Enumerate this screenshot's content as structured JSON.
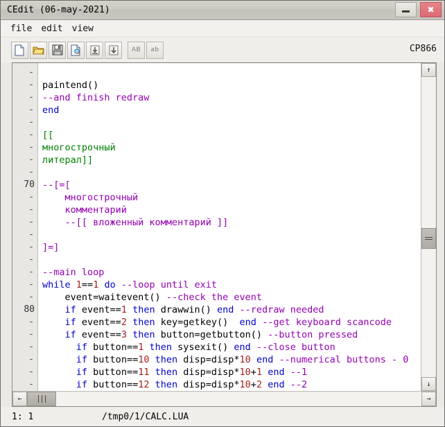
{
  "window": {
    "title": "CEdit (06-may-2021)",
    "minimize_label": "–",
    "close_label": "✖"
  },
  "menubar": {
    "items": [
      {
        "label": "file",
        "name": "menu-file"
      },
      {
        "label": "edit",
        "name": "menu-edit"
      },
      {
        "label": "view",
        "name": "menu-view"
      }
    ]
  },
  "toolbar": {
    "buttons": [
      {
        "icon": "new-file-icon",
        "label": ""
      },
      {
        "icon": "open-folder-icon",
        "label": ""
      },
      {
        "icon": "save-icon",
        "label": ""
      },
      {
        "icon": "save-as-icon",
        "label": ""
      },
      {
        "icon": "find-icon",
        "label": ""
      },
      {
        "icon": "find-next-icon",
        "label": ""
      },
      {
        "icon": "uppercase-icon",
        "label": "AB"
      },
      {
        "icon": "lowercase-icon",
        "label": "ab"
      }
    ],
    "encoding": "CP866"
  },
  "editor": {
    "gutter": [
      "-",
      "-",
      "-",
      "-",
      "-",
      "-",
      "-",
      "-",
      "-",
      "70",
      "-",
      "-",
      "-",
      "-",
      "-",
      "-",
      "-",
      "-",
      "-",
      "80",
      "-",
      "-",
      "-",
      "-",
      "-",
      "-"
    ],
    "lines": [
      [],
      [
        {
          "t": "paintend()",
          "c": "plain"
        }
      ],
      [
        {
          "t": "--and finish redraw",
          "c": "cmt"
        }
      ],
      [
        {
          "t": "end",
          "c": "key"
        }
      ],
      [],
      [
        {
          "t": "[[",
          "c": "str"
        }
      ],
      [
        {
          "t": "многострочный",
          "c": "str"
        }
      ],
      [
        {
          "t": "литерал]]",
          "c": "str"
        }
      ],
      [],
      [
        {
          "t": "--[=[",
          "c": "cmt"
        }
      ],
      [
        {
          "t": "    многострочный",
          "c": "cmt"
        }
      ],
      [
        {
          "t": "    комментарий",
          "c": "cmt"
        }
      ],
      [
        {
          "t": "    --[[ вложенный комментарий ]]",
          "c": "cmt"
        }
      ],
      [],
      [
        {
          "t": "]=]",
          "c": "cmt"
        }
      ],
      [],
      [
        {
          "t": "--main loop",
          "c": "cmt"
        }
      ],
      [
        {
          "t": "while ",
          "c": "key"
        },
        {
          "t": "1",
          "c": "num"
        },
        {
          "t": "==",
          "c": "plain"
        },
        {
          "t": "1",
          "c": "num"
        },
        {
          "t": " ",
          "c": "plain"
        },
        {
          "t": "do",
          "c": "key"
        },
        {
          "t": " ",
          "c": "plain"
        },
        {
          "t": "--loop until exit",
          "c": "cmt"
        }
      ],
      [
        {
          "t": "    event=waitevent() ",
          "c": "plain"
        },
        {
          "t": "--check the event",
          "c": "cmt"
        }
      ],
      [
        {
          "t": "    ",
          "c": "plain"
        },
        {
          "t": "if",
          "c": "key"
        },
        {
          "t": " event==",
          "c": "plain"
        },
        {
          "t": "1",
          "c": "num"
        },
        {
          "t": " ",
          "c": "plain"
        },
        {
          "t": "then",
          "c": "key"
        },
        {
          "t": " drawwin() ",
          "c": "plain"
        },
        {
          "t": "end",
          "c": "key"
        },
        {
          "t": " ",
          "c": "plain"
        },
        {
          "t": "--redraw needed",
          "c": "cmt"
        }
      ],
      [
        {
          "t": "    ",
          "c": "plain"
        },
        {
          "t": "if",
          "c": "key"
        },
        {
          "t": " event==",
          "c": "plain"
        },
        {
          "t": "2",
          "c": "num"
        },
        {
          "t": " ",
          "c": "plain"
        },
        {
          "t": "then",
          "c": "key"
        },
        {
          "t": " key=getkey()  ",
          "c": "plain"
        },
        {
          "t": "end",
          "c": "key"
        },
        {
          "t": " ",
          "c": "plain"
        },
        {
          "t": "--get keyboard scancode",
          "c": "cmt"
        }
      ],
      [
        {
          "t": "    ",
          "c": "plain"
        },
        {
          "t": "if",
          "c": "key"
        },
        {
          "t": " event==",
          "c": "plain"
        },
        {
          "t": "3",
          "c": "num"
        },
        {
          "t": " ",
          "c": "plain"
        },
        {
          "t": "then",
          "c": "key"
        },
        {
          "t": " button=getbutton() ",
          "c": "plain"
        },
        {
          "t": "--button pressed",
          "c": "cmt"
        }
      ],
      [
        {
          "t": "      ",
          "c": "plain"
        },
        {
          "t": "if",
          "c": "key"
        },
        {
          "t": " button==",
          "c": "plain"
        },
        {
          "t": "1",
          "c": "num"
        },
        {
          "t": " ",
          "c": "plain"
        },
        {
          "t": "then",
          "c": "key"
        },
        {
          "t": " sysexit() ",
          "c": "plain"
        },
        {
          "t": "end",
          "c": "key"
        },
        {
          "t": " ",
          "c": "plain"
        },
        {
          "t": "--close button",
          "c": "cmt"
        }
      ],
      [
        {
          "t": "      ",
          "c": "plain"
        },
        {
          "t": "if",
          "c": "key"
        },
        {
          "t": " button==",
          "c": "plain"
        },
        {
          "t": "10",
          "c": "num"
        },
        {
          "t": " ",
          "c": "plain"
        },
        {
          "t": "then",
          "c": "key"
        },
        {
          "t": " disp=disp*",
          "c": "plain"
        },
        {
          "t": "10",
          "c": "num"
        },
        {
          "t": " ",
          "c": "plain"
        },
        {
          "t": "end",
          "c": "key"
        },
        {
          "t": " ",
          "c": "plain"
        },
        {
          "t": "--numerical buttons - 0",
          "c": "cmt"
        }
      ],
      [
        {
          "t": "      ",
          "c": "plain"
        },
        {
          "t": "if",
          "c": "key"
        },
        {
          "t": " button==",
          "c": "plain"
        },
        {
          "t": "11",
          "c": "num"
        },
        {
          "t": " ",
          "c": "plain"
        },
        {
          "t": "then",
          "c": "key"
        },
        {
          "t": " disp=disp*",
          "c": "plain"
        },
        {
          "t": "10",
          "c": "num"
        },
        {
          "t": "+",
          "c": "plain"
        },
        {
          "t": "1",
          "c": "num"
        },
        {
          "t": " ",
          "c": "plain"
        },
        {
          "t": "end",
          "c": "key"
        },
        {
          "t": " ",
          "c": "plain"
        },
        {
          "t": "--1",
          "c": "cmt"
        }
      ],
      [
        {
          "t": "      ",
          "c": "plain"
        },
        {
          "t": "if",
          "c": "key"
        },
        {
          "t": " button==",
          "c": "plain"
        },
        {
          "t": "12",
          "c": "num"
        },
        {
          "t": " ",
          "c": "plain"
        },
        {
          "t": "then",
          "c": "key"
        },
        {
          "t": " disp=disp*",
          "c": "plain"
        },
        {
          "t": "10",
          "c": "num"
        },
        {
          "t": "+",
          "c": "plain"
        },
        {
          "t": "2",
          "c": "num"
        },
        {
          "t": " ",
          "c": "plain"
        },
        {
          "t": "end",
          "c": "key"
        },
        {
          "t": " ",
          "c": "plain"
        },
        {
          "t": "--2",
          "c": "cmt"
        }
      ]
    ],
    "scroll_up_label": "↑",
    "scroll_down_label": "↓",
    "scroll_left_label": "←",
    "scroll_right_label": "→"
  },
  "statusbar": {
    "position": "1: 1",
    "path": "/tmp0/1/CALC.LUA"
  },
  "colors": {
    "keyword": "#0000c8",
    "number": "#a52020",
    "comment": "#9400b3",
    "string": "#008000",
    "plain": "#000000",
    "close_button": "#dd6a72"
  }
}
